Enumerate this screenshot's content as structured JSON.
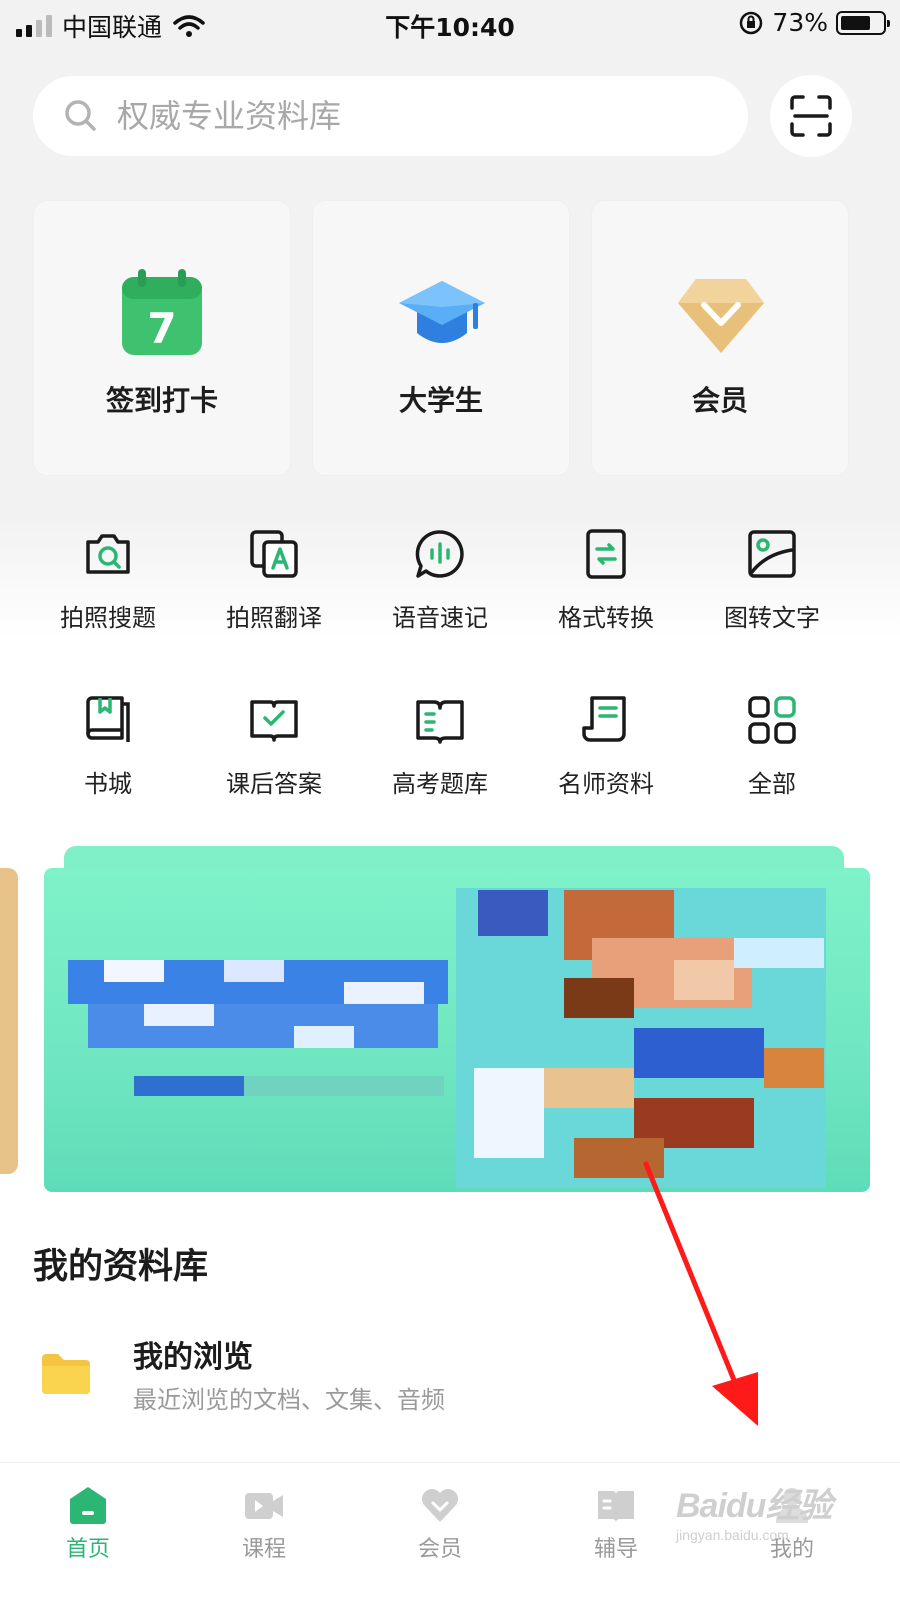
{
  "status_bar": {
    "carrier": "中国联通",
    "time": "下午10:40",
    "battery": "73%",
    "battery_level": 0.73
  },
  "search": {
    "placeholder": "权威专业资料库"
  },
  "feature_cards": [
    {
      "label": "签到打卡",
      "icon": "calendar-icon",
      "icon_text": "7"
    },
    {
      "label": "大学生",
      "icon": "graduation-cap-icon"
    },
    {
      "label": "会员",
      "icon": "diamond-icon"
    }
  ],
  "tools": [
    {
      "label": "拍照搜题",
      "icon": "camera-search-icon"
    },
    {
      "label": "拍照翻译",
      "icon": "translate-icon"
    },
    {
      "label": "语音速记",
      "icon": "voice-memo-icon"
    },
    {
      "label": "格式转换",
      "icon": "format-convert-icon"
    },
    {
      "label": "图转文字",
      "icon": "image-to-text-icon"
    },
    {
      "label": "书城",
      "icon": "bookstore-icon"
    },
    {
      "label": "课后答案",
      "icon": "answer-icon"
    },
    {
      "label": "高考题库",
      "icon": "exam-bank-icon"
    },
    {
      "label": "名师资料",
      "icon": "teacher-materials-icon"
    },
    {
      "label": "全部",
      "icon": "all-apps-icon"
    }
  ],
  "library": {
    "title": "我的资料库",
    "items": [
      {
        "title": "我的浏览",
        "subtitle": "最近浏览的文档、文集、音频",
        "icon": "folder-icon"
      }
    ]
  },
  "bottom_nav": [
    {
      "label": "首页",
      "icon": "home-icon",
      "active": true
    },
    {
      "label": "课程",
      "icon": "video-icon",
      "active": false
    },
    {
      "label": "会员",
      "icon": "vip-heart-icon",
      "active": false
    },
    {
      "label": "辅导",
      "icon": "book-open-icon",
      "active": false
    },
    {
      "label": "我的",
      "icon": "profile-icon",
      "active": false
    }
  ],
  "watermark": {
    "brand": "Baidu经验",
    "url": "jingyan.baidu.com"
  },
  "colors": {
    "accent": "#2bb673",
    "annotation_arrow": "#ff1a1a"
  }
}
